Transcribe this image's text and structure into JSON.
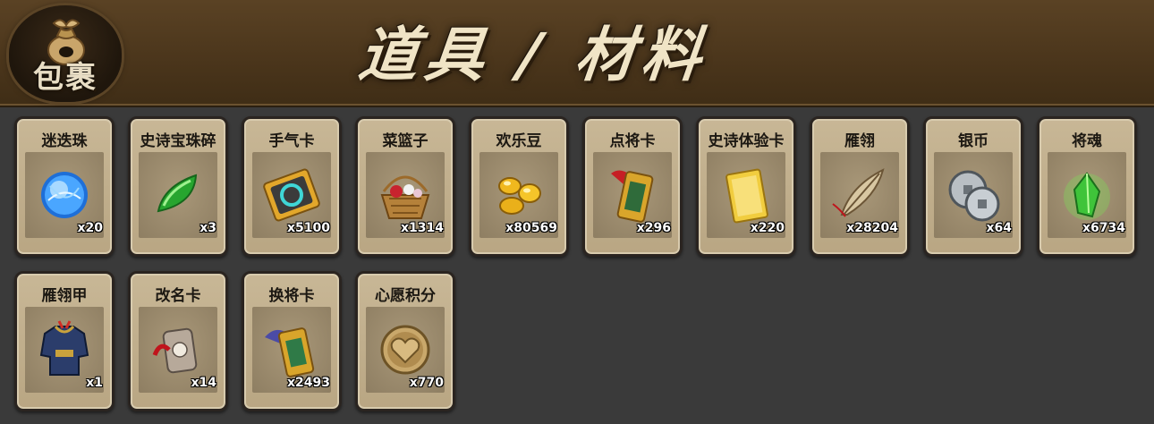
{
  "header": {
    "badge_label": "包裹",
    "badge_icon": "money-bag-icon",
    "title": "道具 / 材料"
  },
  "items": [
    {
      "name": "迷迭珠",
      "count": "x20",
      "icon": "blue-orb-icon"
    },
    {
      "name": "史诗宝珠碎",
      "count": "x3",
      "icon": "green-shard-icon"
    },
    {
      "name": "手气卡",
      "count": "x5100",
      "icon": "luck-card-icon"
    },
    {
      "name": "菜篮子",
      "count": "x1314",
      "icon": "flower-basket-icon"
    },
    {
      "name": "欢乐豆",
      "count": "x80569",
      "icon": "gold-beans-icon"
    },
    {
      "name": "点将卡",
      "count": "x296",
      "icon": "general-token-icon"
    },
    {
      "name": "史诗体验卡",
      "count": "x220",
      "icon": "gold-card-icon"
    },
    {
      "name": "雁翎",
      "count": "x28204",
      "icon": "feather-icon"
    },
    {
      "name": "银币",
      "count": "x64",
      "icon": "silver-coins-icon"
    },
    {
      "name": "将魂",
      "count": "x6734",
      "icon": "green-crystal-icon"
    },
    {
      "name": "雁翎甲",
      "count": "x1",
      "icon": "armor-icon"
    },
    {
      "name": "改名卡",
      "count": "x14",
      "icon": "rename-tag-icon"
    },
    {
      "name": "换将卡",
      "count": "x2493",
      "icon": "swap-token-icon"
    },
    {
      "name": "心愿积分",
      "count": "x770",
      "icon": "heart-coin-icon"
    }
  ]
}
